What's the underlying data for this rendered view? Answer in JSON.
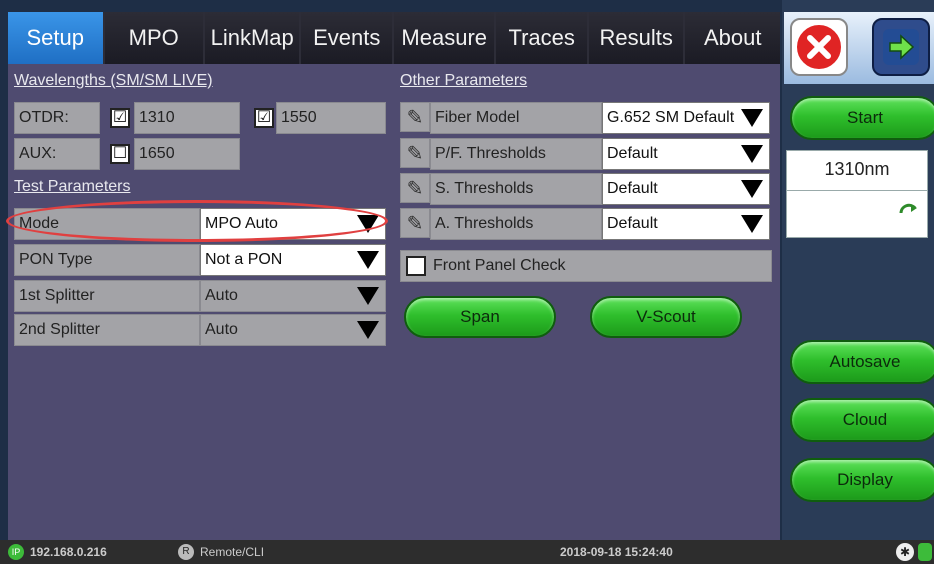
{
  "tabs": [
    "Setup",
    "MPO",
    "LinkMap",
    "Events",
    "Measure",
    "Traces",
    "Results",
    "About"
  ],
  "wavelengths": {
    "title": "Wavelengths (SM/SM LIVE)",
    "otdr_label": "OTDR:",
    "otdr_1": {
      "value": "1310",
      "checked": "☑"
    },
    "otdr_2": {
      "value": "1550",
      "checked": "☑"
    },
    "aux_label": "AUX:",
    "aux_1": {
      "value": "1650",
      "checked": "☐"
    }
  },
  "test_params": {
    "title": "Test Parameters",
    "rows": [
      {
        "label": "Mode",
        "value": "MPO Auto"
      },
      {
        "label": "PON Type",
        "value": "Not a PON"
      },
      {
        "label": "1st Splitter",
        "value": "Auto"
      },
      {
        "label": "2nd Splitter",
        "value": "Auto"
      }
    ]
  },
  "other_params": {
    "title": "Other Parameters",
    "rows": [
      {
        "label": "Fiber Model",
        "value": "G.652 SM Default"
      },
      {
        "label": "P/F. Thresholds",
        "value": "Default"
      },
      {
        "label": "S. Thresholds",
        "value": "Default"
      },
      {
        "label": "A. Thresholds",
        "value": "Default"
      }
    ],
    "front_panel": "Front Panel Check"
  },
  "buttons": {
    "span": "Span",
    "vscout": "V-Scout",
    "start": "Start",
    "autosave": "Autosave",
    "cloud": "Cloud",
    "display": "Display"
  },
  "side": {
    "wave": "1310nm"
  },
  "status": {
    "ip": "192.168.0.216",
    "remote": "Remote/CLI",
    "datetime": "2018-09-18 15:24:40"
  },
  "colors": {
    "accent": "#2a82d8",
    "green": "#2fbf2c",
    "highlight": "#e04040"
  }
}
